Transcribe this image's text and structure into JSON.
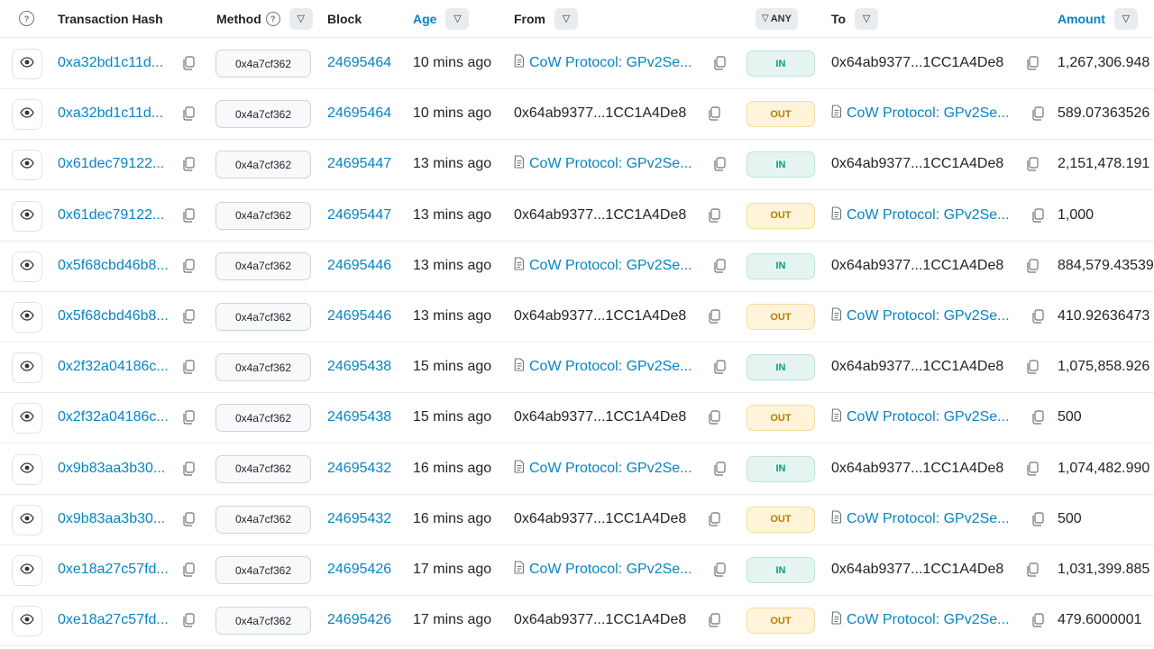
{
  "header": {
    "help_icon": "question-circle-icon",
    "tx_hash": "Transaction Hash",
    "method": "Method",
    "block": "Block",
    "age": "Age",
    "from": "From",
    "any": "ANY",
    "to": "To",
    "amount": "Amount",
    "filter_glyph": "▽"
  },
  "rows": [
    {
      "hash": "0xa32bd1c11d...",
      "method": "0x4a7cf362",
      "block": "24695464",
      "age": "10 mins ago",
      "from": "CoW Protocol: GPv2Se...",
      "from_contract": true,
      "dir": "IN",
      "to": "0x64ab9377...1CC1A4De8",
      "to_contract": false,
      "amount": "1,267,306.948"
    },
    {
      "hash": "0xa32bd1c11d...",
      "method": "0x4a7cf362",
      "block": "24695464",
      "age": "10 mins ago",
      "from": "0x64ab9377...1CC1A4De8",
      "from_contract": false,
      "dir": "OUT",
      "to": "CoW Protocol: GPv2Se...",
      "to_contract": true,
      "amount": "589.07363526"
    },
    {
      "hash": "0x61dec79122...",
      "method": "0x4a7cf362",
      "block": "24695447",
      "age": "13 mins ago",
      "from": "CoW Protocol: GPv2Se...",
      "from_contract": true,
      "dir": "IN",
      "to": "0x64ab9377...1CC1A4De8",
      "to_contract": false,
      "amount": "2,151,478.191"
    },
    {
      "hash": "0x61dec79122...",
      "method": "0x4a7cf362",
      "block": "24695447",
      "age": "13 mins ago",
      "from": "0x64ab9377...1CC1A4De8",
      "from_contract": false,
      "dir": "OUT",
      "to": "CoW Protocol: GPv2Se...",
      "to_contract": true,
      "amount": "1,000"
    },
    {
      "hash": "0x5f68cbd46b8...",
      "method": "0x4a7cf362",
      "block": "24695446",
      "age": "13 mins ago",
      "from": "CoW Protocol: GPv2Se...",
      "from_contract": true,
      "dir": "IN",
      "to": "0x64ab9377...1CC1A4De8",
      "to_contract": false,
      "amount": "884,579.43539"
    },
    {
      "hash": "0x5f68cbd46b8...",
      "method": "0x4a7cf362",
      "block": "24695446",
      "age": "13 mins ago",
      "from": "0x64ab9377...1CC1A4De8",
      "from_contract": false,
      "dir": "OUT",
      "to": "CoW Protocol: GPv2Se...",
      "to_contract": true,
      "amount": "410.92636473"
    },
    {
      "hash": "0x2f32a04186c...",
      "method": "0x4a7cf362",
      "block": "24695438",
      "age": "15 mins ago",
      "from": "CoW Protocol: GPv2Se...",
      "from_contract": true,
      "dir": "IN",
      "to": "0x64ab9377...1CC1A4De8",
      "to_contract": false,
      "amount": "1,075,858.926"
    },
    {
      "hash": "0x2f32a04186c...",
      "method": "0x4a7cf362",
      "block": "24695438",
      "age": "15 mins ago",
      "from": "0x64ab9377...1CC1A4De8",
      "from_contract": false,
      "dir": "OUT",
      "to": "CoW Protocol: GPv2Se...",
      "to_contract": true,
      "amount": "500"
    },
    {
      "hash": "0x9b83aa3b30...",
      "method": "0x4a7cf362",
      "block": "24695432",
      "age": "16 mins ago",
      "from": "CoW Protocol: GPv2Se...",
      "from_contract": true,
      "dir": "IN",
      "to": "0x64ab9377...1CC1A4De8",
      "to_contract": false,
      "amount": "1,074,482.990"
    },
    {
      "hash": "0x9b83aa3b30...",
      "method": "0x4a7cf362",
      "block": "24695432",
      "age": "16 mins ago",
      "from": "0x64ab9377...1CC1A4De8",
      "from_contract": false,
      "dir": "OUT",
      "to": "CoW Protocol: GPv2Se...",
      "to_contract": true,
      "amount": "500"
    },
    {
      "hash": "0xe18a27c57fd...",
      "method": "0x4a7cf362",
      "block": "24695426",
      "age": "17 mins ago",
      "from": "CoW Protocol: GPv2Se...",
      "from_contract": true,
      "dir": "IN",
      "to": "0x64ab9377...1CC1A4De8",
      "to_contract": false,
      "amount": "1,031,399.885"
    },
    {
      "hash": "0xe18a27c57fd...",
      "method": "0x4a7cf362",
      "block": "24695426",
      "age": "17 mins ago",
      "from": "0x64ab9377...1CC1A4De8",
      "from_contract": false,
      "dir": "OUT",
      "to": "CoW Protocol: GPv2Se...",
      "to_contract": true,
      "amount": "479.6000001"
    }
  ],
  "colors": {
    "link": "#0784c3",
    "in_text": "#00a186",
    "out_text": "#b47d00"
  }
}
